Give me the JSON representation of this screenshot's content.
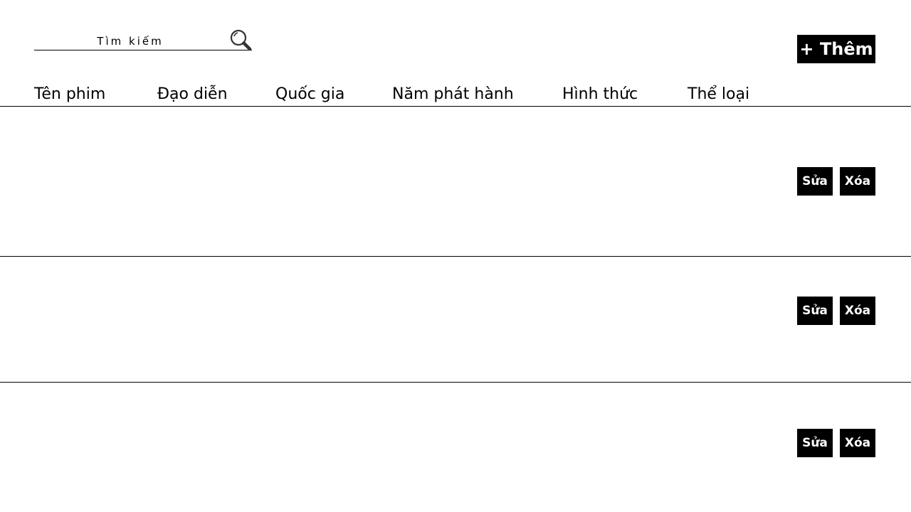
{
  "search": {
    "placeholder": "Tìm kiếm"
  },
  "toolbar": {
    "add_label": "+ Thêm"
  },
  "table": {
    "columns": [
      "Tên phim",
      "Đạo diễn",
      "Quốc gia",
      "Năm phát hành",
      "Hình thức",
      "Thể loại"
    ],
    "rows": [
      {
        "edit_label": "Sửa",
        "delete_label": "Xóa"
      },
      {
        "edit_label": "Sửa",
        "delete_label": "Xóa"
      },
      {
        "edit_label": "Sửa",
        "delete_label": "Xóa"
      }
    ]
  },
  "icons": {
    "search": "search-icon"
  }
}
